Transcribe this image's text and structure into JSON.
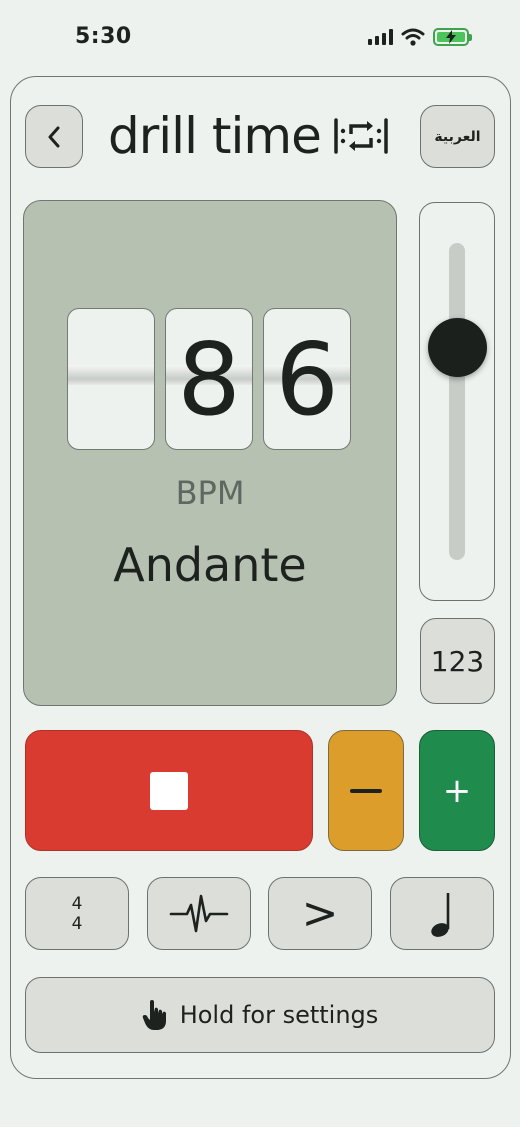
{
  "status_bar": {
    "time": "5:30"
  },
  "header": {
    "back_icon": "chevron-left-icon",
    "app_name": "drill time",
    "language_button": "العربية"
  },
  "display": {
    "digits": [
      "",
      "8",
      "6"
    ],
    "unit_label": "BPM",
    "tempo_name": "Andante"
  },
  "slider": {
    "level": 0.67
  },
  "number_button": "123",
  "transport": {
    "stop_icon": "stop-icon",
    "minus_icon": "minus-icon",
    "plus_label": "+"
  },
  "tools": {
    "time_signature": {
      "top": "4",
      "bottom": "4"
    },
    "pulse_icon": "waveform-icon",
    "accent_label": ">",
    "note_icon": "quarter-note-icon"
  },
  "hold_button": {
    "icon": "hand-pointer-icon",
    "label": "Hold for settings"
  },
  "colors": {
    "stop": "#d93b31",
    "minus": "#dd9d2b",
    "plus": "#1f8b4d",
    "display": "#b6c1b1",
    "battery": "#4cc45c"
  }
}
